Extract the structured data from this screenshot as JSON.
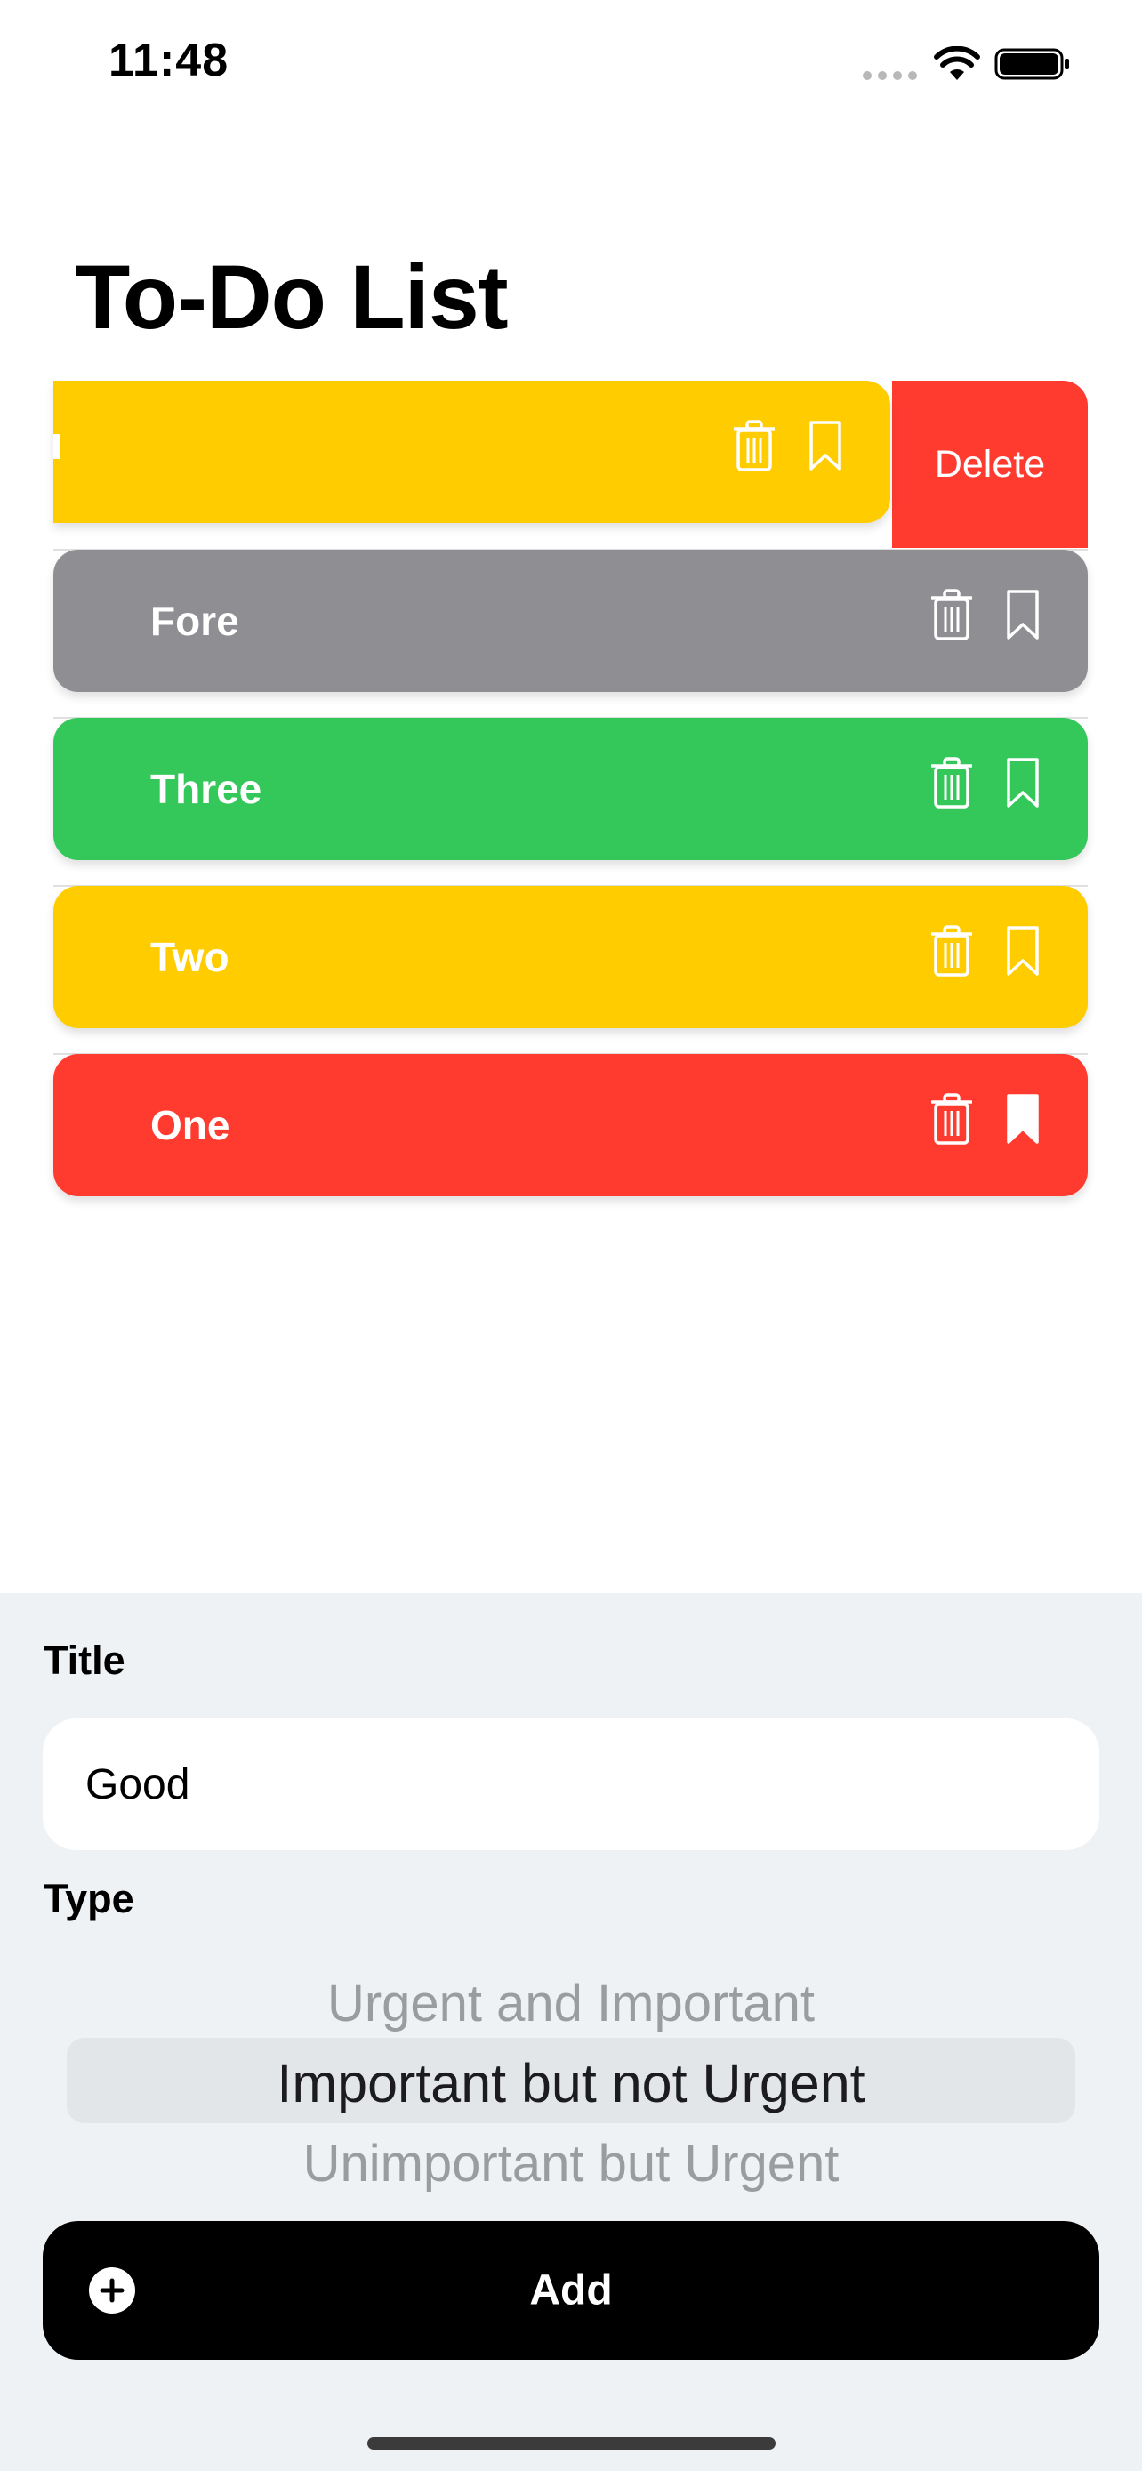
{
  "status_bar": {
    "time": "11:48"
  },
  "page": {
    "title": "To-Do List"
  },
  "list": {
    "swipe_action_label": "Delete",
    "items": [
      {
        "title": "",
        "color": "#ffcc00",
        "bookmarked": false,
        "swiped": true
      },
      {
        "title": "Fore",
        "color": "#8e8e93",
        "bookmarked": false,
        "swiped": false
      },
      {
        "title": "Three",
        "color": "#34c759",
        "bookmarked": false,
        "swiped": false
      },
      {
        "title": "Two",
        "color": "#ffcc00",
        "bookmarked": false,
        "swiped": false
      },
      {
        "title": "One",
        "color": "#ff3b30",
        "bookmarked": true,
        "swiped": false
      }
    ]
  },
  "form": {
    "title_label": "Title",
    "title_value": "Good",
    "type_label": "Type",
    "type_options": [
      "Urgent and Important",
      "Important but not Urgent",
      "Unimportant but Urgent"
    ],
    "type_selected": "Important but not Urgent",
    "add_label": "Add"
  },
  "icons": {
    "status": [
      "signal-icon",
      "wifi-icon",
      "battery-icon"
    ],
    "row": [
      "trash-icon",
      "bookmark-icon"
    ],
    "add": "plus-circle-icon"
  }
}
